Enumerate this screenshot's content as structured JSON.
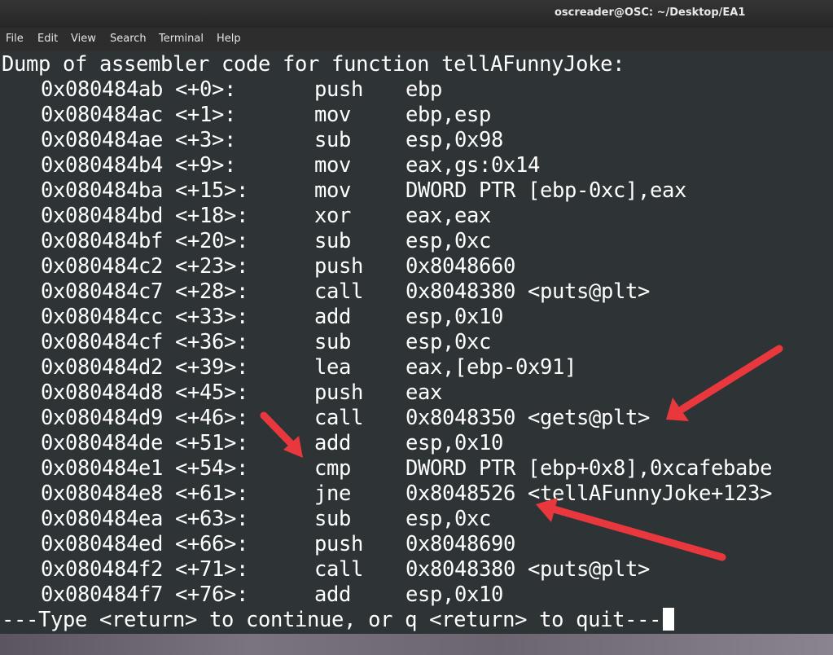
{
  "window": {
    "title": "oscreader@OSC: ~/Desktop/EA1"
  },
  "menu": [
    "File",
    "Edit",
    "View",
    "Search",
    "Terminal",
    "Help"
  ],
  "terminal": {
    "header": "Dump of assembler code for function tellAFunnyJoke:",
    "rows": [
      {
        "addr": "0x080484ab <+0>:",
        "mnem": "push",
        "ops": "ebp"
      },
      {
        "addr": "0x080484ac <+1>:",
        "mnem": "mov",
        "ops": "ebp,esp"
      },
      {
        "addr": "0x080484ae <+3>:",
        "mnem": "sub",
        "ops": "esp,0x98"
      },
      {
        "addr": "0x080484b4 <+9>:",
        "mnem": "mov",
        "ops": "eax,gs:0x14"
      },
      {
        "addr": "0x080484ba <+15>:",
        "mnem": "mov",
        "ops": "DWORD PTR [ebp-0xc],eax"
      },
      {
        "addr": "0x080484bd <+18>:",
        "mnem": "xor",
        "ops": "eax,eax"
      },
      {
        "addr": "0x080484bf <+20>:",
        "mnem": "sub",
        "ops": "esp,0xc"
      },
      {
        "addr": "0x080484c2 <+23>:",
        "mnem": "push",
        "ops": "0x8048660"
      },
      {
        "addr": "0x080484c7 <+28>:",
        "mnem": "call",
        "ops": "0x8048380 <puts@plt>"
      },
      {
        "addr": "0x080484cc <+33>:",
        "mnem": "add",
        "ops": "esp,0x10"
      },
      {
        "addr": "0x080484cf <+36>:",
        "mnem": "sub",
        "ops": "esp,0xc"
      },
      {
        "addr": "0x080484d2 <+39>:",
        "mnem": "lea",
        "ops": "eax,[ebp-0x91]"
      },
      {
        "addr": "0x080484d8 <+45>:",
        "mnem": "push",
        "ops": "eax"
      },
      {
        "addr": "0x080484d9 <+46>:",
        "mnem": "call",
        "ops": "0x8048350 <gets@plt>"
      },
      {
        "addr": "0x080484de <+51>:",
        "mnem": "add",
        "ops": "esp,0x10"
      },
      {
        "addr": "0x080484e1 <+54>:",
        "mnem": "cmp",
        "ops": "DWORD PTR [ebp+0x8],0xcafebabe"
      },
      {
        "addr": "0x080484e8 <+61>:",
        "mnem": "jne",
        "ops": "0x8048526 <tellAFunnyJoke+123>"
      },
      {
        "addr": "0x080484ea <+63>:",
        "mnem": "sub",
        "ops": "esp,0xc"
      },
      {
        "addr": "0x080484ed <+66>:",
        "mnem": "push",
        "ops": "0x8048690"
      },
      {
        "addr": "0x080484f2 <+71>:",
        "mnem": "call",
        "ops": "0x8048380 <puts@plt>"
      },
      {
        "addr": "0x080484f7 <+76>:",
        "mnem": "add",
        "ops": "esp,0x10"
      }
    ],
    "prompt": "---Type <return> to continue, or q <return> to quit---"
  },
  "colors": {
    "terminal_bg": "#2e3436",
    "terminal_fg": "#ffffff",
    "annotation_arrow": "#e8383d"
  }
}
